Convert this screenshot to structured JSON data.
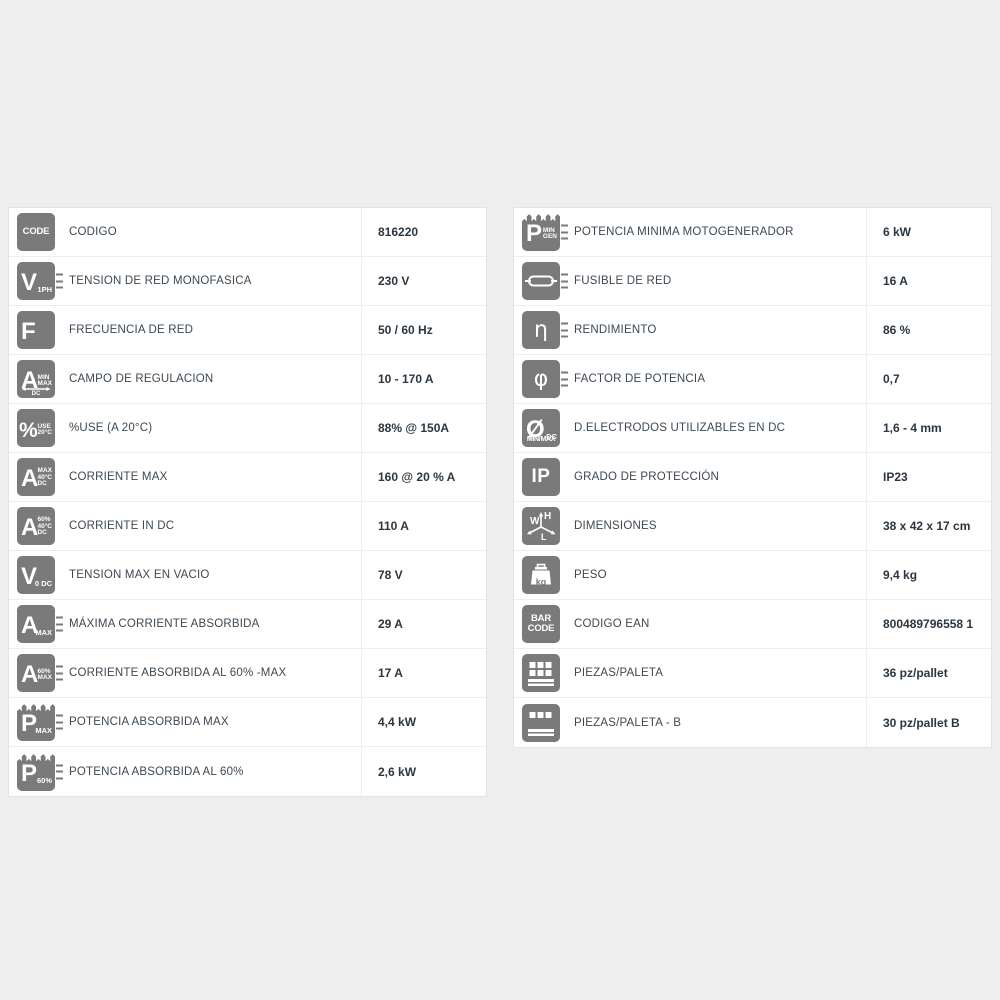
{
  "background_color": "#eeeeee",
  "card_color": "#ffffff",
  "icon_color": "#7a7a7a",
  "label_color": "#3d4852",
  "value_color": "#2b3640",
  "tables": {
    "left": {
      "rows": [
        {
          "icon": "code-icon",
          "label": "CODIGO",
          "value": "816220"
        },
        {
          "icon": "mains-voltage-1ph-icon",
          "label": "TENSION DE RED MONOFASICA",
          "value": "230 V"
        },
        {
          "icon": "frequency-icon",
          "label": "FRECUENCIA DE RED",
          "value": "50 / 60 Hz"
        },
        {
          "icon": "current-range-min-max-icon",
          "label": "CAMPO DE REGULACION",
          "value": "10 - 170 A"
        },
        {
          "icon": "duty-cycle-percent-icon",
          "label": "%USE (A 20°C)",
          "value": "88% @ 150A"
        },
        {
          "icon": "current-max-icon",
          "label": "CORRIENTE MAX",
          "value": "160 @ 20 % A"
        },
        {
          "icon": "current-60-dc-icon",
          "label": "CORRIENTE IN DC",
          "value": "110 A"
        },
        {
          "icon": "open-circuit-voltage-icon",
          "label": "TENSION MAX EN VACIO",
          "value": "78 V"
        },
        {
          "icon": "absorbed-current-max-icon",
          "label": "MÁXIMA CORRIENTE ABSORBIDA",
          "value": "29 A"
        },
        {
          "icon": "absorbed-current-60-icon",
          "label": "CORRIENTE ABSORBIDA AL 60% -MAX",
          "value": "17 A"
        },
        {
          "icon": "absorbed-power-max-icon",
          "label": "POTENCIA ABSORBIDA MAX",
          "value": "4,4 kW"
        },
        {
          "icon": "absorbed-power-60-icon",
          "label": "POTENCIA ABSORBIDA AL 60%",
          "value": "2,6 kW"
        }
      ]
    },
    "right": {
      "rows": [
        {
          "icon": "generator-min-power-icon",
          "label": "POTENCIA MINIMA MOTOGENERADOR",
          "value": "6 kW"
        },
        {
          "icon": "fuse-icon",
          "label": "FUSIBLE DE RED",
          "value": "16 A"
        },
        {
          "icon": "efficiency-eta-icon",
          "label": "RENDIMIENTO",
          "value": "86 %"
        },
        {
          "icon": "power-factor-phi-icon",
          "label": "FACTOR DE POTENCIA",
          "value": "0,7"
        },
        {
          "icon": "electrode-diameter-icon",
          "label": "D.ELECTRODOS UTILIZABLES EN DC",
          "value": "1,6 - 4 mm"
        },
        {
          "icon": "ip-rating-icon",
          "label": "GRADO DE PROTECCIÓN",
          "value": "IP23"
        },
        {
          "icon": "dimensions-whl-icon",
          "label": "DIMENSIONES",
          "value": "38 x 42 x 17 cm"
        },
        {
          "icon": "weight-kg-icon",
          "label": "PESO",
          "value": "9,4 kg"
        },
        {
          "icon": "barcode-icon",
          "label": "CODIGO EAN",
          "value": "800489796558 1"
        },
        {
          "icon": "pallet-pieces-icon",
          "label": "PIEZAS/PALETA",
          "value": "36 pz/pallet"
        },
        {
          "icon": "pallet-pieces-b-icon",
          "label": "PIEZAS/PALETA - B",
          "value": "30 pz/pallet B"
        }
      ]
    }
  },
  "icon_glyphs": {
    "code-icon": {
      "text": "CODE"
    },
    "mains-voltage-1ph-icon": {
      "main": "V",
      "sub": "1PH",
      "ticks": true
    },
    "frequency-icon": {
      "main": "F"
    },
    "current-range-min-max-icon": {
      "main": "A",
      "sub_top": "MIN",
      "sub_bottom": "MAX",
      "foot": "DC"
    },
    "duty-cycle-percent-icon": {
      "main": "%",
      "sub_top": "USE",
      "sub_bottom": "20°C"
    },
    "current-max-icon": {
      "main": "A",
      "sub1": "MAX",
      "sub2": "40°C",
      "sub3": "DC"
    },
    "current-60-dc-icon": {
      "main": "A",
      "sub1": "60%",
      "sub2": "40°C",
      "sub3": "DC"
    },
    "open-circuit-voltage-icon": {
      "main": "V",
      "sub": "0",
      "sub_b": "DC"
    },
    "absorbed-current-max-icon": {
      "main": "A",
      "sub": "MAX",
      "ticks": true
    },
    "absorbed-current-60-icon": {
      "main": "A",
      "sub_top": "60%",
      "sub_bottom": "MAX",
      "ticks": true
    },
    "absorbed-power-max-icon": {
      "main": "P",
      "sub": "MAX",
      "jagged": true,
      "ticks": true
    },
    "absorbed-power-60-icon": {
      "main": "P",
      "sub": "60%",
      "jagged": true,
      "ticks": true
    },
    "generator-min-power-icon": {
      "main": "P",
      "sub_top": "MIN",
      "sub_bottom": "GEN",
      "jagged": true,
      "ticks": true
    },
    "fuse-icon": {
      "shape": "fuse",
      "ticks": true
    },
    "efficiency-eta-icon": {
      "greek": "η",
      "ticks": true
    },
    "power-factor-phi-icon": {
      "greek": "φ",
      "ticks": true
    },
    "electrode-diameter-icon": {
      "main": "Ø",
      "sub": "DC",
      "bottom": "MIN/MAX"
    },
    "ip-rating-icon": {
      "text": "IP"
    },
    "dimensions-whl-icon": {
      "shape": "whl"
    },
    "weight-kg-icon": {
      "shape": "weight",
      "text": "kg"
    },
    "barcode-icon": {
      "line1": "BAR",
      "line2": "CODE"
    },
    "pallet-pieces-icon": {
      "shape": "pallet"
    },
    "pallet-pieces-b-icon": {
      "shape": "pallet-b"
    }
  }
}
